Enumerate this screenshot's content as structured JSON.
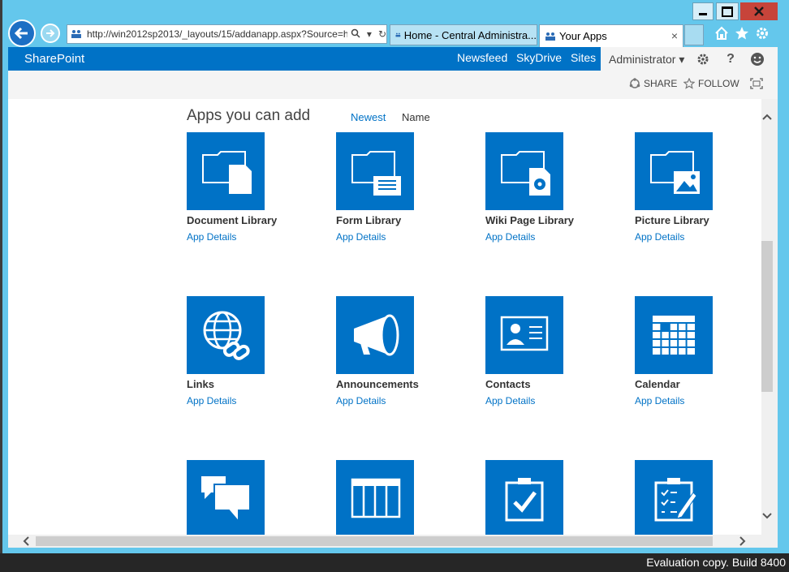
{
  "browser": {
    "url": "http://win2012sp2013/_layouts/15/addanapp.aspx?Source=h",
    "tabs": [
      {
        "label": "Home - Central Administra..."
      },
      {
        "label": "Your Apps"
      }
    ],
    "tab_close_glyph": "×"
  },
  "suite": {
    "brand": "SharePoint",
    "links": [
      "Newsfeed",
      "SkyDrive",
      "Sites"
    ],
    "user": "Administrator ▾",
    "help": "?"
  },
  "ribbon": {
    "share": "SHARE",
    "follow": "FOLLOW"
  },
  "apps_section": {
    "title": "Apps you can add",
    "sort_newest": "Newest",
    "sort_name": "Name",
    "details_label": "App Details",
    "apps": [
      {
        "name": "Document Library",
        "icon": "document-library-icon"
      },
      {
        "name": "Form Library",
        "icon": "form-library-icon"
      },
      {
        "name": "Wiki Page Library",
        "icon": "wiki-page-library-icon"
      },
      {
        "name": "Picture Library",
        "icon": "picture-library-icon"
      },
      {
        "name": "Links",
        "icon": "links-icon"
      },
      {
        "name": "Announcements",
        "icon": "announcements-icon"
      },
      {
        "name": "Contacts",
        "icon": "contacts-icon"
      },
      {
        "name": "Calendar",
        "icon": "calendar-icon"
      },
      {
        "name": "",
        "icon": "discussion-board-icon"
      },
      {
        "name": "",
        "icon": "custom-list-icon"
      },
      {
        "name": "",
        "icon": "tasks-icon"
      },
      {
        "name": "",
        "icon": "issue-tracking-icon"
      }
    ]
  },
  "taskbar": {
    "evaluation_text": "Evaluation copy. Build 8400"
  },
  "colors": {
    "sharepoint_blue": "#0072c6",
    "window_frame": "#64c7ec",
    "close_red": "#c7443a"
  }
}
